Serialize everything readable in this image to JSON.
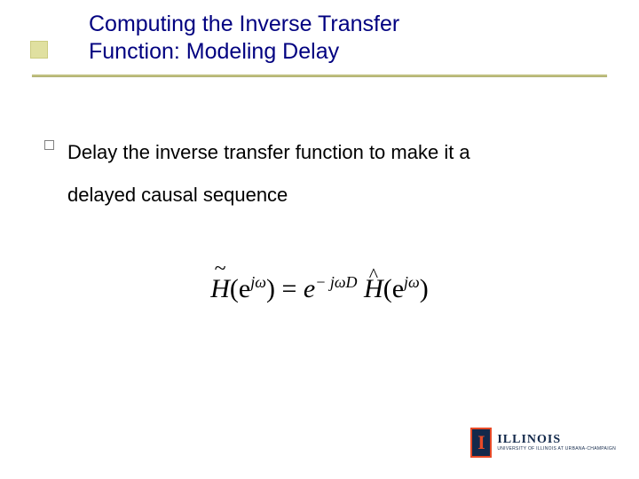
{
  "title": {
    "line1": "Computing the Inverse Transfer",
    "line2": "Function: Modeling Delay"
  },
  "body": {
    "line1": "Delay the inverse transfer function to make it a",
    "line2": "delayed causal sequence"
  },
  "equation": {
    "lhs_symbol": "H",
    "lhs_arg_pre": "(e",
    "lhs_exp": "jω",
    "lhs_arg_post": ")",
    "eq": " = ",
    "factor_pre": "e",
    "factor_exp": "− jωD",
    "rhs_symbol": "H",
    "rhs_arg_pre": "(e",
    "rhs_exp": "jω",
    "rhs_arg_post": ")"
  },
  "logo": {
    "letter": "I",
    "word": "ILLINOIS",
    "sub": "UNIVERSITY OF ILLINOIS AT URBANA-CHAMPAIGN"
  }
}
